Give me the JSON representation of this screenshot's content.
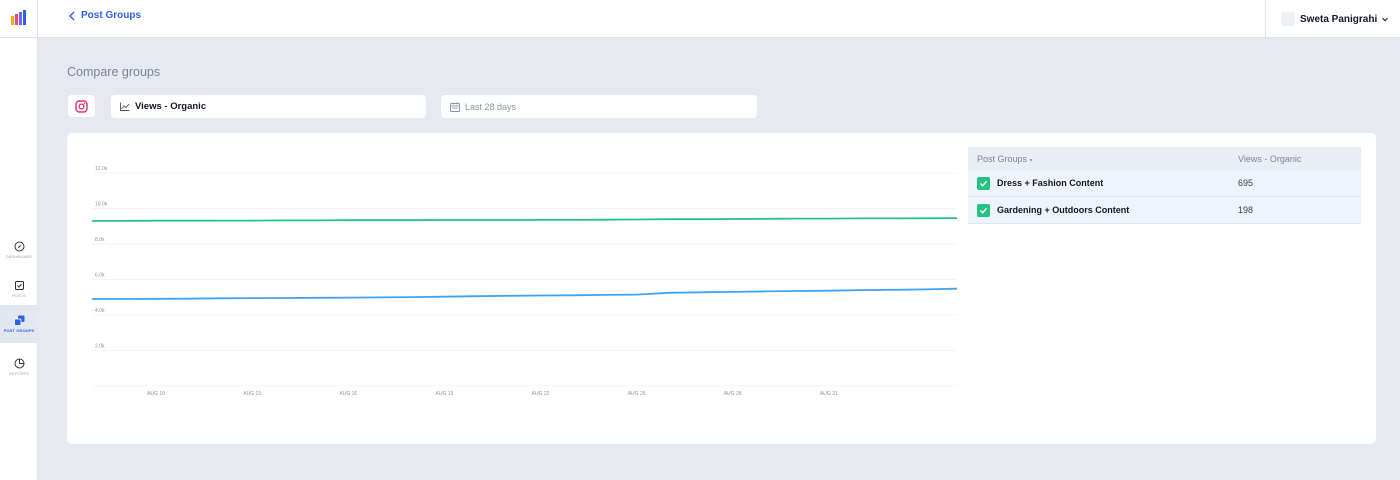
{
  "header": {
    "back_label": "Post Groups",
    "user_name": "Sweta Panigrahi"
  },
  "sidebar": {
    "items": [
      {
        "label": "Dashboard",
        "icon": "compass-icon",
        "active": false
      },
      {
        "label": "Posts",
        "icon": "post-icon",
        "active": false
      },
      {
        "label": "Post Groups",
        "icon": "post-groups-icon",
        "active": true
      },
      {
        "label": "Reports",
        "icon": "reports-icon",
        "active": false
      }
    ]
  },
  "page": {
    "title": "Compare groups"
  },
  "filters": {
    "platform_icon": "instagram-icon",
    "metric": "Views - Organic",
    "date_range": "Last 28 days"
  },
  "colors": {
    "accent": "#2f62e0",
    "series_green": "#26c281",
    "series_blue": "#3fa3f3"
  },
  "chart_data": {
    "type": "line",
    "x": [
      "AUG 8",
      "AUG 9",
      "AUG 10",
      "AUG 11",
      "AUG 12",
      "AUG 13",
      "AUG 14",
      "AUG 15",
      "AUG 16",
      "AUG 17",
      "AUG 18",
      "AUG 19",
      "AUG 20",
      "AUG 21",
      "AUG 22",
      "AUG 23",
      "AUG 24",
      "AUG 25",
      "AUG 26",
      "AUG 27",
      "AUG 28",
      "AUG 29",
      "AUG 30",
      "AUG 31",
      "SEP 1",
      "SEP 2",
      "SEP 3",
      "SEP 4"
    ],
    "xticks": [
      "AUG 10",
      "AUG 13",
      "AUG 16",
      "AUG 19",
      "AUG 22",
      "AUG 25",
      "AUG 28",
      "AUG 31"
    ],
    "yticks": [
      "2.0k",
      "4.0k",
      "6.0k",
      "8.0k",
      "10.0k",
      "12.0k"
    ],
    "ylim": [
      0,
      12000
    ],
    "grid": true,
    "series": [
      {
        "name": "Dress + Fashion Content",
        "color": "#26c281",
        "values": [
          9300,
          9300,
          9310,
          9310,
          9320,
          9320,
          9330,
          9330,
          9340,
          9340,
          9340,
          9350,
          9350,
          9350,
          9360,
          9360,
          9370,
          9380,
          9400,
          9400,
          9410,
          9420,
          9430,
          9430,
          9440,
          9440,
          9450,
          9460
        ]
      },
      {
        "name": "Gardening + Outdoors Content",
        "color": "#3fa3f3",
        "values": [
          4900,
          4900,
          4910,
          4920,
          4940,
          4950,
          4960,
          4970,
          4980,
          4990,
          5010,
          5030,
          5060,
          5080,
          5100,
          5110,
          5130,
          5150,
          5250,
          5280,
          5300,
          5330,
          5350,
          5370,
          5400,
          5420,
          5440,
          5480
        ]
      }
    ]
  },
  "table": {
    "headers": {
      "group": "Post Groups",
      "views": "Views - Organic"
    },
    "rows": [
      {
        "name": "Dress + Fashion Content",
        "value": "695",
        "checked": true
      },
      {
        "name": "Gardening + Outdoors Content",
        "value": "198",
        "checked": true
      }
    ]
  }
}
